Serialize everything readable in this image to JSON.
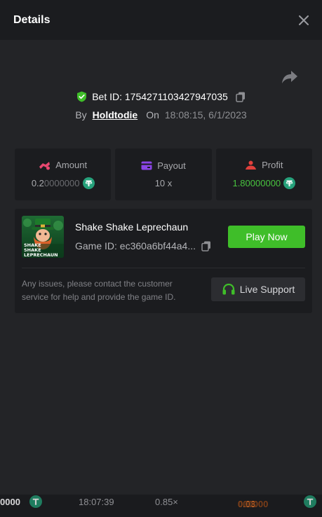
{
  "header": {
    "title": "Details"
  },
  "bet": {
    "id_label": "Bet ID: 1754271103427947035",
    "by_label": "By",
    "username": "Holdtodie",
    "on_label": "On",
    "timestamp": "18:08:15, 6/1/2023"
  },
  "stats": {
    "amount": {
      "label": "Amount",
      "value_main": "0.2",
      "value_dim": "0000000"
    },
    "payout": {
      "label": "Payout",
      "value": "10 x"
    },
    "profit": {
      "label": "Profit",
      "value_main": "1.8",
      "value_dim": "0000000"
    }
  },
  "game": {
    "name": "Shake Shake Leprechaun",
    "game_id": "Game ID: ec360a6bf44a4...",
    "thumbnail_text": "SHAKE SHAKE LEPRECHAUN",
    "play_label": "Play Now",
    "issue_text": "Any issues, please contact the customer service for help and provide the game ID.",
    "support_label": "Live Support"
  },
  "background_row": {
    "left_amount": "0000",
    "time": "18:07:39",
    "multiplier": "0.85×",
    "right_amount_main": "0.03",
    "right_amount_dim": "000000"
  },
  "colors": {
    "accent_green": "#3fbe29",
    "profit_green": "#48c23e",
    "amount_pink": "#e8476f",
    "payout_purple": "#8b45e6",
    "profit_red": "#e0403c",
    "tether": "#26a17b"
  },
  "icons": [
    "close-icon",
    "share-icon",
    "shield-check-icon",
    "copy-icon",
    "amount-icon",
    "wallet-icon",
    "profit-icon",
    "tether-coin-icon",
    "headset-icon"
  ]
}
